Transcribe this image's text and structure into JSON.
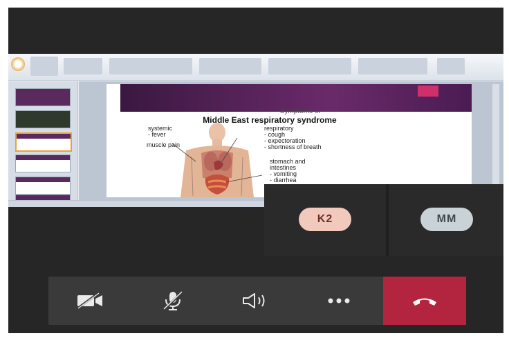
{
  "slide": {
    "title_line1": "Symptoms of",
    "title_line2": "Middle East respiratory syndrome",
    "symptoms": {
      "systemic": [
        "systemic",
        "- fever"
      ],
      "muscle": [
        "muscle pain"
      ],
      "respiratory": [
        "respiratory",
        "- cough",
        "- expectoration",
        "- shortness of breath"
      ],
      "gastro": [
        "stomach and",
        "intestines",
        "- vomiting",
        "- diarrhea"
      ]
    }
  },
  "participants": [
    {
      "initials": "K2",
      "color": "#f2c9bd"
    },
    {
      "initials": "MM",
      "color": "#c9d2d6"
    }
  ],
  "controls": {
    "camera_icon": "camera-off-icon",
    "mic_icon": "mic-off-icon",
    "speaker_icon": "speaker-icon",
    "more_icon": "more-options-icon",
    "hangup_icon": "hang-up-icon",
    "hangup_color": "#b3243f"
  }
}
